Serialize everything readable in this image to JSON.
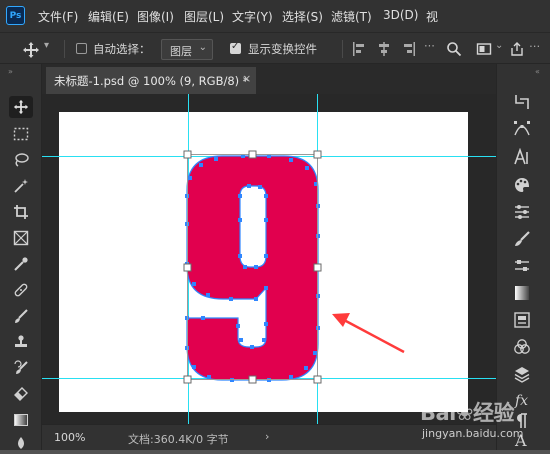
{
  "app": {
    "logo_text": "Ps"
  },
  "menu": [
    {
      "label": "文件(F)"
    },
    {
      "label": "编辑(E)"
    },
    {
      "label": "图像(I)"
    },
    {
      "label": "图层(L)"
    },
    {
      "label": "文字(Y)"
    },
    {
      "label": "选择(S)"
    },
    {
      "label": "滤镜(T)"
    },
    {
      "label": "3D(D)"
    },
    {
      "label": "视"
    }
  ],
  "options": {
    "auto_select_label": "自动选择：",
    "auto_select_checked": false,
    "auto_select_target": "图层",
    "show_transform_label": "显示变换控件",
    "show_transform_checked": true
  },
  "document_tab": {
    "title": "未标题-1.psd @ 100% (9, RGB/8) *",
    "close": "×"
  },
  "canvas": {
    "glyph": "9",
    "glyph_color": "#e1004e",
    "guide_color": "#00e5ff",
    "anchor_color": "#2f86ff",
    "arrow_color": "#ff3b3b"
  },
  "status": {
    "zoom": "100%",
    "doc_info": "文档:360.4K/0 字节",
    "arrow": "›"
  },
  "watermark": {
    "brand": "Bai❀经验",
    "url": "jingyan.baidu.com"
  },
  "tools": [
    "move-tool-icon",
    "marquee-tool-icon",
    "lasso-tool-icon",
    "magic-wand-tool-icon",
    "crop-tool-icon",
    "frame-tool-icon",
    "eyedropper-tool-icon",
    "healing-brush-tool-icon",
    "brush-tool-icon",
    "clone-stamp-tool-icon",
    "history-brush-tool-icon",
    "eraser-tool-icon",
    "gradient-tool-icon",
    "blur-tool-icon"
  ],
  "panels": [
    "history-panel-icon",
    "paths-panel-icon",
    "character-panel-icon",
    "swatches-panel-icon",
    "adjustments-panel-icon",
    "brushes-panel-icon",
    "properties-panel-icon",
    "gradients-panel-icon",
    "libraries-panel-icon",
    "channels-panel-icon",
    "layers-panel-icon",
    "styles-panel-icon",
    "paragraph-panel-icon",
    "glyphs-panel-icon"
  ]
}
